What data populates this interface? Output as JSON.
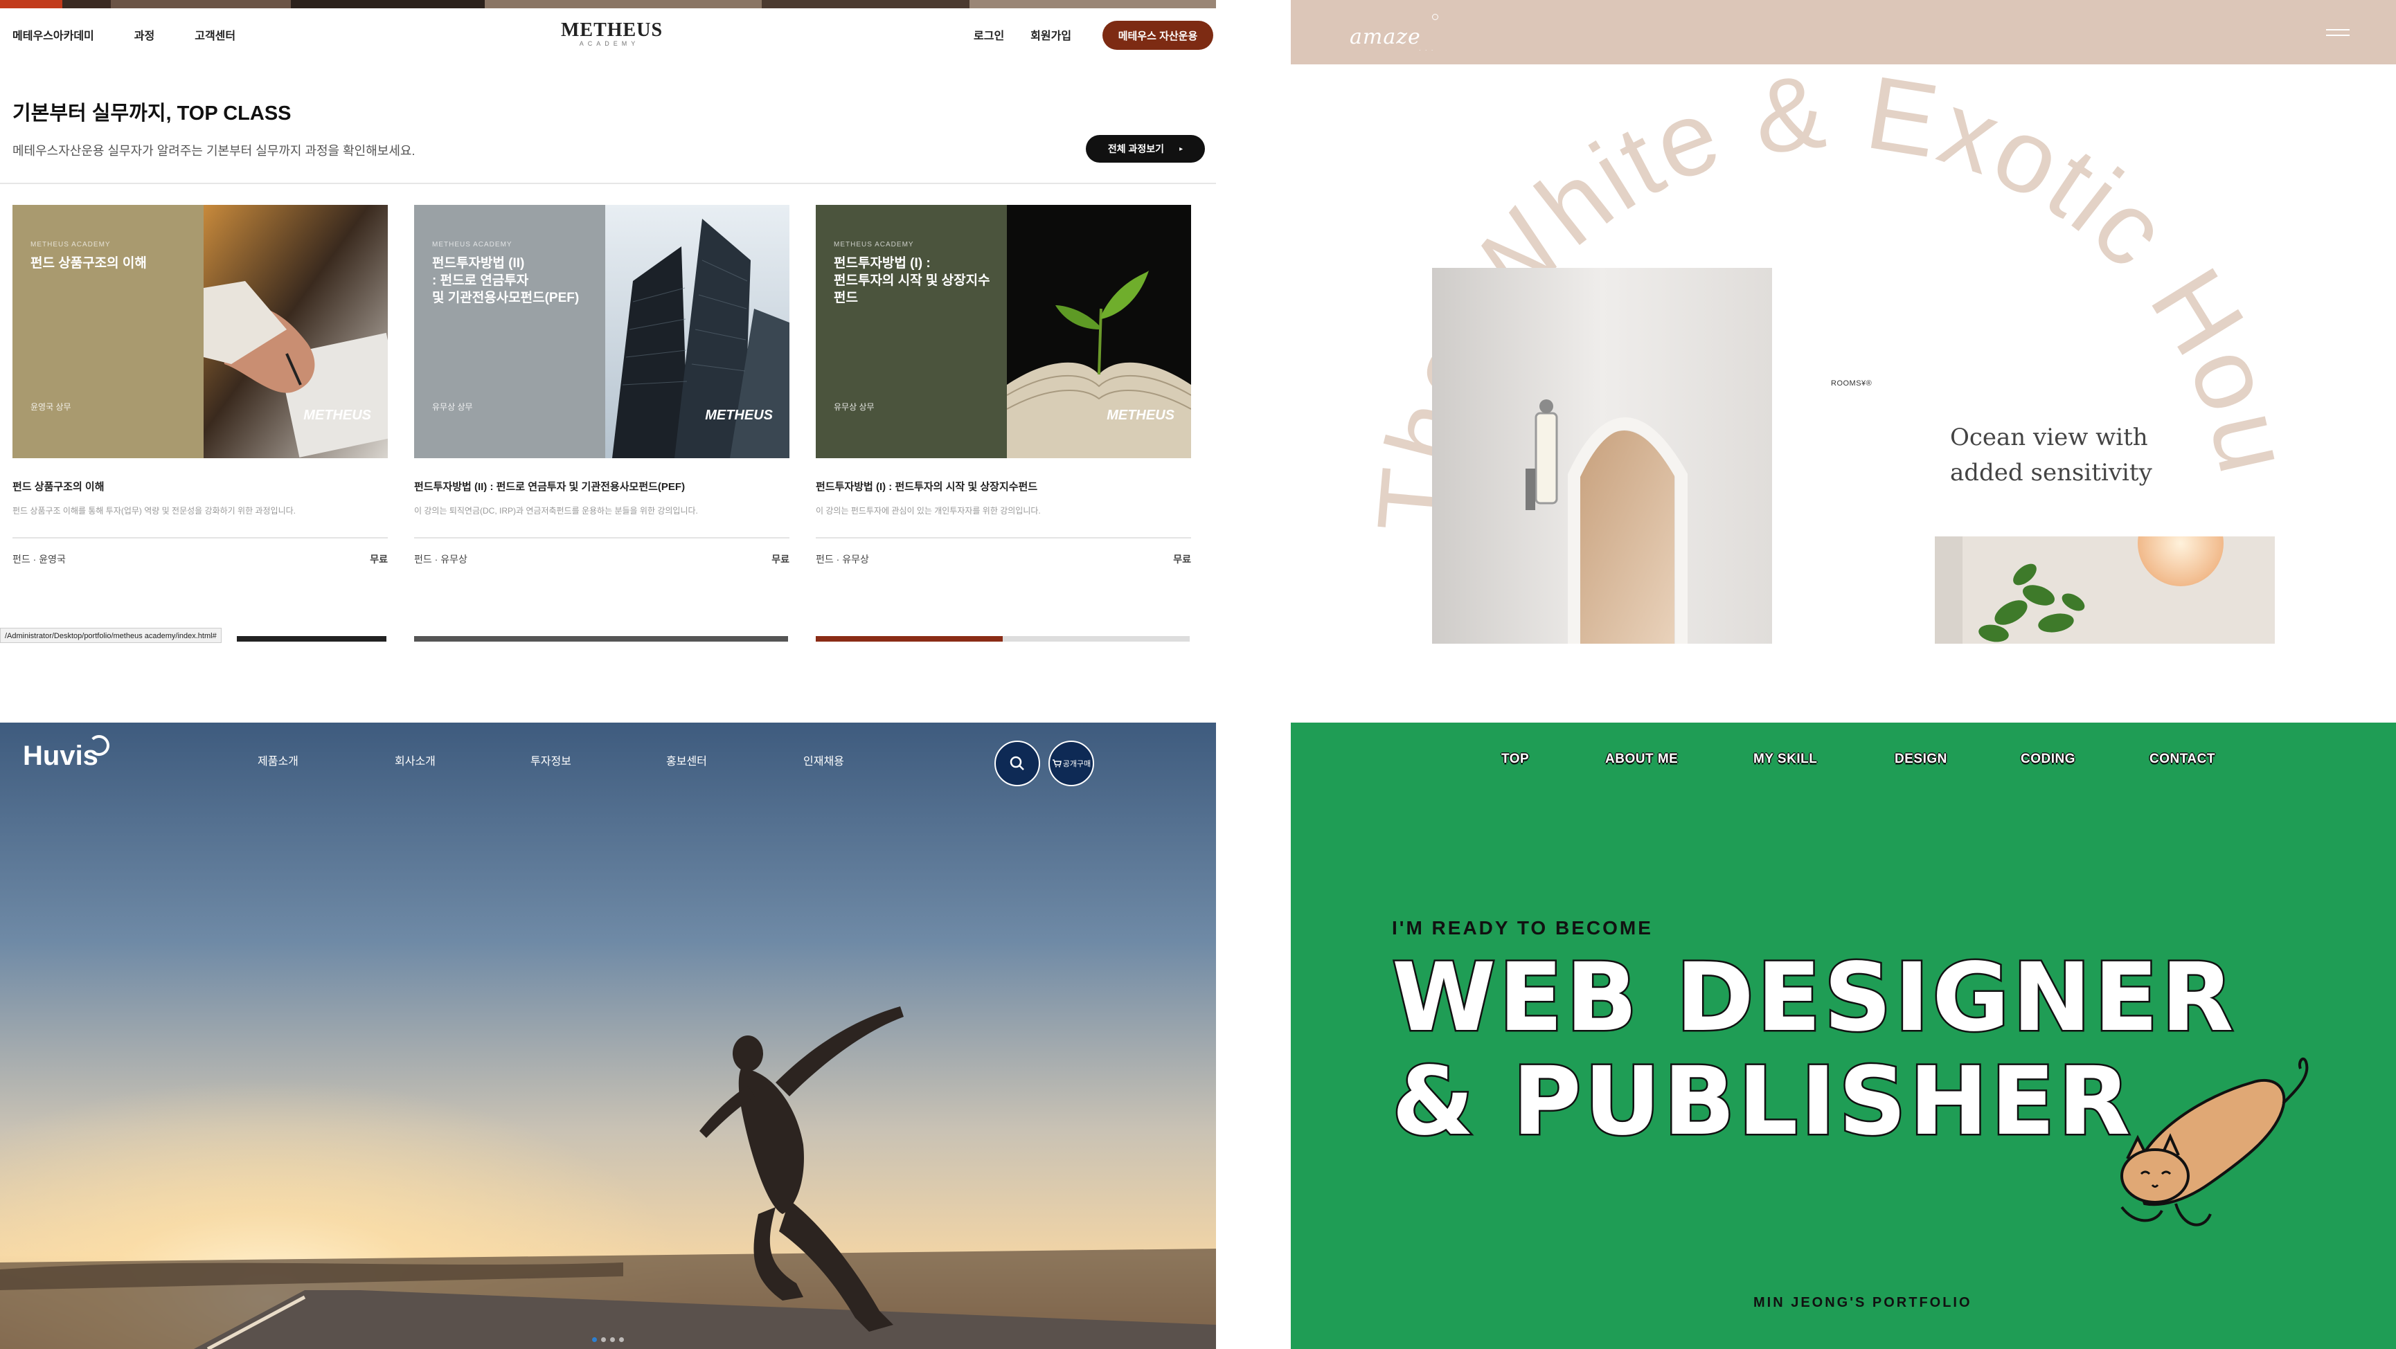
{
  "metheus": {
    "nav_left": [
      "메테우스아카데미",
      "과정",
      "고객센터"
    ],
    "logo": {
      "name": "METHEUS",
      "sub": "ACADEMY"
    },
    "nav_right": [
      "로그인",
      "회원가입"
    ],
    "cta": "메테우스 자산운용",
    "section_title": "기본부터 실무까지, TOP CLASS",
    "section_sub": "메테우스자산운용 실무자가 알려주는 기본부터 실무까지 과정을 확인해보세요.",
    "all_courses_btn": "전체 과정보기",
    "all_courses_arrow": "▸",
    "cards": [
      {
        "thumb_academy": "METHEUS ACADEMY",
        "thumb_title": "펀드 상품구조의 이해",
        "thumb_instructor": "윤영국 상무",
        "thumb_brand": "METHEUS",
        "title": "펀드 상품구조의 이해",
        "desc": "펀드 상품구조 이해를 통해 투자(업무) 역량 및 전문성을 강화하기 위한 과정입니다.",
        "category": "펀드 · 윤영국",
        "price": "무료"
      },
      {
        "thumb_academy": "METHEUS ACADEMY",
        "thumb_title": "펀드투자방법 (II)\n: 펀드로 연금투자\n 및 기관전용사모펀드(PEF)",
        "thumb_instructor": "유무상 상무",
        "thumb_brand": "METHEUS",
        "title": "펀드투자방법 (II) : 펀드로 연금투자 및 기관전용사모펀드(PEF)",
        "desc": "이 강의는 퇴직연금(DC, IRP)과 연금저축펀드를 운용하는 분들을 위한 강의입니다.",
        "category": "펀드 · 유무상",
        "price": "무료"
      },
      {
        "thumb_academy": "METHEUS ACADEMY",
        "thumb_title": "펀드투자방법 (I) :\n펀드투자의 시작 및 상장지수펀드",
        "thumb_instructor": "유무상 상무",
        "thumb_brand": "METHEUS",
        "title": "펀드투자방법 (I) : 펀드투자의 시작 및 상장지수펀드",
        "desc": "이 강의는 펀드투자에 관심이 있는 개인투자자를 위한 강의입니다.",
        "category": "펀드 · 유무상",
        "price": "무료"
      }
    ],
    "status_url": "/Administrator/Desktop/portfolio/metheus academy/index.html#"
  },
  "amaze": {
    "logo": "amaze",
    "arc_text": "The White & Exotic Hou",
    "rooms_label": "ROOMS¥®",
    "tagline_1": "Ocean view with",
    "tagline_2": "added sensitivity"
  },
  "huvis": {
    "logo": "Huvis",
    "nav": [
      "제품소개",
      "회사소개",
      "투자정보",
      "홍보센터",
      "인재채용"
    ],
    "cart_label": "공개구매",
    "search_icon": "search-icon",
    "slide_count": 4,
    "active_slide": 1
  },
  "portfolio": {
    "nav": [
      "TOP",
      "ABOUT ME",
      "MY SKILL",
      "DESIGN",
      "CODING",
      "CONTACT"
    ],
    "kicker": "I'M READY TO BECOME",
    "line1": "WEB DESIGNER",
    "line2": "& PUBLISHER",
    "footer": "MIN JEONG'S PORTFOLIO",
    "bg_color": "#1f9d55"
  }
}
